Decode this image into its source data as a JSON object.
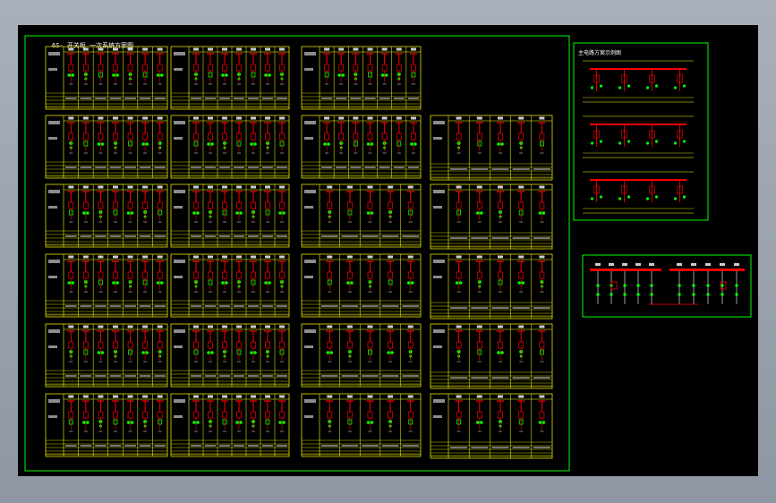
{
  "drawing": {
    "main_title": "6S- 开关柜 一次系统方案图",
    "right_title": "主电路方案示例图",
    "colors": {
      "background": "#000000",
      "frame": "#00ff00",
      "table_lines": "#ffff00",
      "bus": "#ff0000",
      "components": "#00ff00",
      "tick_labels": "#ffffff",
      "screen_bg": "#a9b0bb"
    }
  },
  "panel_grid": {
    "columns": 4,
    "rows": 6,
    "cubicles_per_panel": [
      [
        7,
        7,
        7,
        0
      ],
      [
        7,
        7,
        7,
        5
      ],
      [
        7,
        7,
        5,
        5
      ],
      [
        7,
        7,
        5,
        5
      ],
      [
        7,
        7,
        5,
        5
      ],
      [
        7,
        7,
        5,
        5
      ]
    ]
  },
  "right_scheme": {
    "blocks": 3,
    "cubicles_per_block": 4
  },
  "bus_diagram": {
    "left_feeders": 5,
    "right_feeders": 5
  }
}
